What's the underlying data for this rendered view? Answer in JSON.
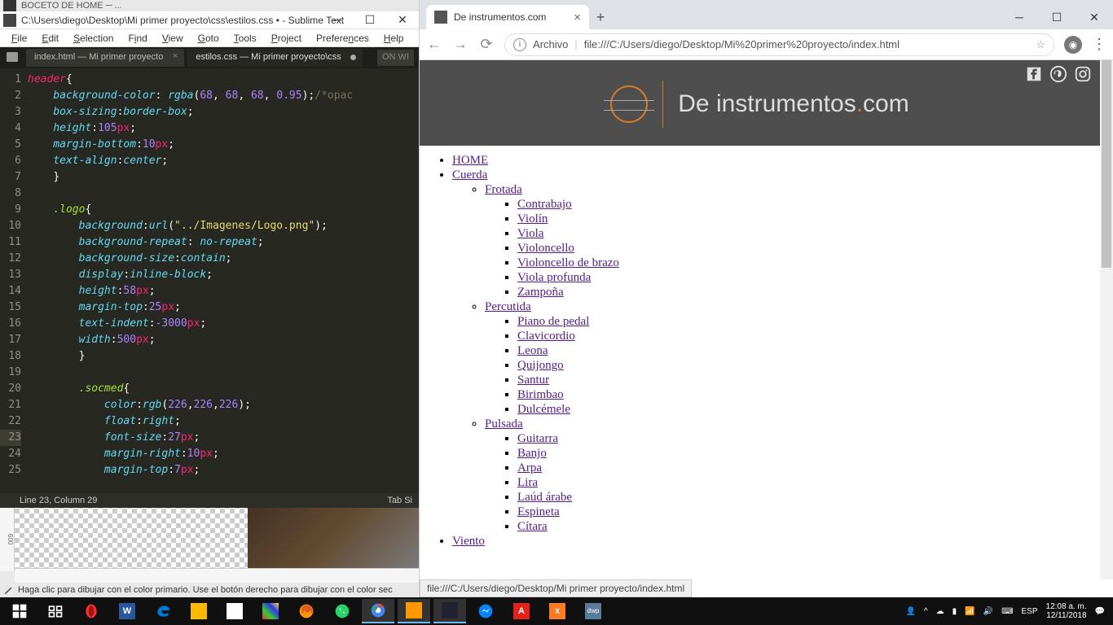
{
  "sublime": {
    "peek_title": "BOCETO DE HOME ─ ...",
    "window_title": "C:\\Users\\diego\\Desktop\\Mi primer proyecto\\css\\estilos.css • - Sublime Text (UNREGISTERED)",
    "menu": [
      "File",
      "Edit",
      "Selection",
      "Find",
      "View",
      "Goto",
      "Tools",
      "Project",
      "Preferences",
      "Help"
    ],
    "tabs": {
      "t1": "index.html — Mi primer proyecto",
      "t2": "estilos.css — Mi primer proyecto\\css",
      "more": "ON  WI"
    },
    "line_numbers": [
      "1",
      "2",
      "3",
      "4",
      "5",
      "6",
      "7",
      "8",
      "9",
      "10",
      "11",
      "12",
      "13",
      "14",
      "15",
      "16",
      "17",
      "18",
      "19",
      "20",
      "21",
      "22",
      "23",
      "24",
      "25"
    ],
    "status_left": "Line 23, Column 29",
    "status_right": "Tab Si",
    "code": {
      "l1_sel": "header",
      "l1_br": "{",
      "l2_prop": "background-color",
      "l2_fn": "rgba",
      "l2_a": "68",
      "l2_b": "68",
      "l2_c": "68",
      "l2_d": "0.95",
      "l2_cm": "/*opac",
      "l3_prop": "box-sizing",
      "l3_val": "border-box",
      "l4_prop": "height",
      "l4_num": "105",
      "l4_u": "px",
      "l5_prop": "margin-bottom",
      "l5_num": "10",
      "l5_u": "px",
      "l6_prop": "text-align",
      "l6_val": "center",
      "l9_sel": ".logo",
      "l10_prop": "background",
      "l10_fn": "url",
      "l10_str": "\"../Imagenes/Logo.png\"",
      "l11_prop": "background-repeat",
      "l11_val": "no-repeat",
      "l12_prop": "background-size",
      "l12_val": "contain",
      "l13_prop": "display",
      "l13_val": "inline-block",
      "l14_prop": "height",
      "l14_num": "58",
      "l14_u": "px",
      "l15_prop": "margin-top",
      "l15_num": "25",
      "l15_u": "px",
      "l16_prop": "text-indent",
      "l16_num": "-3000",
      "l16_u": "px",
      "l17_prop": "width",
      "l17_num": "500",
      "l17_u": "px",
      "l20_sel": ".socmed",
      "l21_prop": "color",
      "l21_fn": "rgb",
      "l21_a": "226",
      "l21_b": "226",
      "l21_c": "226",
      "l22_prop": "float",
      "l22_val": "right",
      "l23_prop": "font-size",
      "l23_num": "27",
      "l23_u": "px",
      "l24_prop": "margin-right",
      "l24_num": "10",
      "l24_u": "px",
      "l25_prop": "margin-top",
      "l25_num": "7",
      "l25_u": "px"
    }
  },
  "ps": {
    "ruler_v": "600",
    "hint": "Haga clic para dibujar con el color primario. Use el botón derecho para dibujar con el color sec"
  },
  "chrome": {
    "tab_title": "De instrumentos.com",
    "url_prefix": "Archivo",
    "url_path": "file:///C:/Users/diego/Desktop/Mi%20primer%20proyecto/index.html",
    "status_url": "file:///C:/Users/diego/Desktop/Mi primer proyecto/index.html",
    "logo_pre": "De instrumentos",
    "logo_dot": ".",
    "logo_suf": "com",
    "nav": {
      "home": "HOME",
      "cuerda": "Cuerda",
      "frotada": "Frotada",
      "frotada_items": [
        "Contrabajo",
        "Violín",
        "Viola",
        "Violoncello",
        "Violoncello de brazo",
        "Viola profunda",
        "Zampoña"
      ],
      "percutida": "Percutida",
      "percutida_items": [
        "Piano de pedal",
        "Clavicordio",
        "Leona",
        "Quijongo",
        "Santur",
        "Birimbao",
        "Dulcémele"
      ],
      "pulsada": "Pulsada",
      "pulsada_items": [
        "Guitarra",
        "Banjo",
        "Arpa",
        "Lira",
        "Laúd árabe",
        "Espineta",
        "Cítara"
      ],
      "viento": "Viento"
    }
  },
  "taskbar": {
    "lang": "ESP",
    "time": "12:08 a. m.",
    "date": "12/11/2018"
  }
}
